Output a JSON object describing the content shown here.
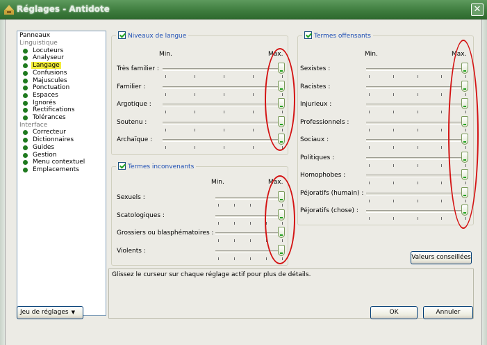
{
  "window": {
    "title": "Réglages - Antidote",
    "close_glyph": "✕"
  },
  "panels": {
    "header": "Panneaux",
    "groups": [
      {
        "label": "Linguistique",
        "items": [
          "Locuteurs",
          "Analyseur",
          "Langage",
          "Confusions",
          "Majuscules",
          "Ponctuation",
          "Espaces",
          "Ignorés",
          "Rectifications",
          "Tolérances"
        ]
      },
      {
        "label": "Interface",
        "items": [
          "Correcteur",
          "Dictionnaires",
          "Guides",
          "Gestion",
          "Menu contextuel",
          "Emplacements"
        ]
      }
    ],
    "selected": "Langage",
    "dot_color": "#1f7a1f",
    "highlight_color": "#f3ec3a"
  },
  "niveaux": {
    "title": "Niveaux de langue",
    "checked": true,
    "min": "Min.",
    "max": "Max.",
    "rows": [
      "Très familier :",
      "Familier :",
      "Argotique :",
      "Soutenu :",
      "Archaïque :"
    ],
    "level": 1.0
  },
  "inconvenants": {
    "title": "Termes inconvenants",
    "checked": true,
    "min": "Min.",
    "max": "Max.",
    "rows": [
      "Sexuels :",
      "Scatologiques :",
      "Grossiers ou blasphématoires :",
      "Violents :"
    ],
    "level": 1.0
  },
  "offensants": {
    "title": "Termes offensants",
    "checked": true,
    "min": "Min.",
    "max": "Max.",
    "rows": [
      "Sexistes :",
      "Racistes :",
      "Injurieux :",
      "Professionnels :",
      "Sociaux :",
      "Politiques :",
      "Homophobes :",
      "Péjoratifs (humain) :",
      "Péjoratifs (chose) :"
    ],
    "level": 1.0
  },
  "buttons": {
    "valeurs": "Valeurs conseillées",
    "jeu": "Jeu de réglages",
    "ok": "OK",
    "annuler": "Annuler"
  },
  "info": "Glissez le curseur sur chaque réglage actif pour plus de détails.",
  "colors": {
    "title_bar": "#3f7d3f",
    "check_mark": "#21a121",
    "annotation_ring": "#d41414",
    "group_title": "#1e4fb5"
  },
  "icons": {
    "app": "antidote-app-icon",
    "close": "close-icon",
    "check": "check-icon",
    "dropdown": "triangle-down-icon"
  }
}
